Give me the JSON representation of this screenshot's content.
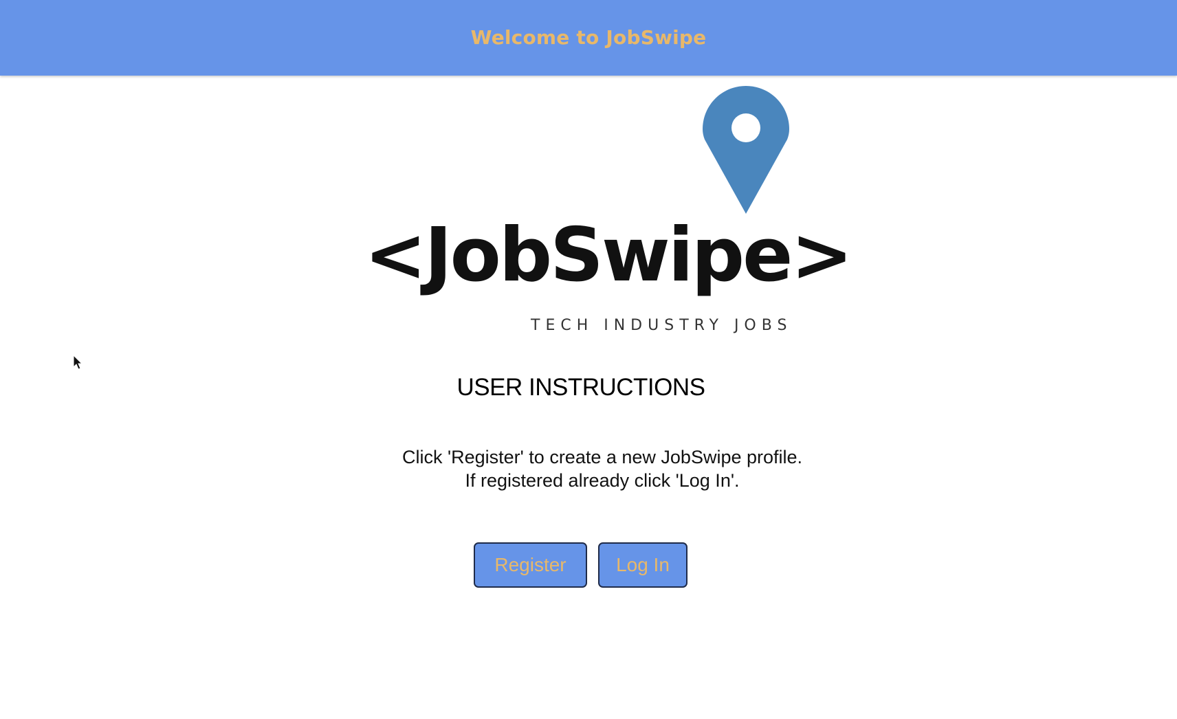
{
  "header": {
    "title": "Welcome to JobSwipe"
  },
  "logo": {
    "wordmark": "<JobSwipe>",
    "tagline": "TECH INDUSTRY JOBS",
    "pin_color": "#4a86bd"
  },
  "instructions": {
    "heading": "USER INSTRUCTIONS",
    "line1": "Click 'Register' to create a new JobSwipe profile.",
    "line2": "If registered already click 'Log In'."
  },
  "actions": {
    "register_label": "Register",
    "login_label": "Log In"
  },
  "colors": {
    "header_bg": "#6694e8",
    "accent_text": "#e8b86a",
    "button_border": "#1f2b49"
  }
}
